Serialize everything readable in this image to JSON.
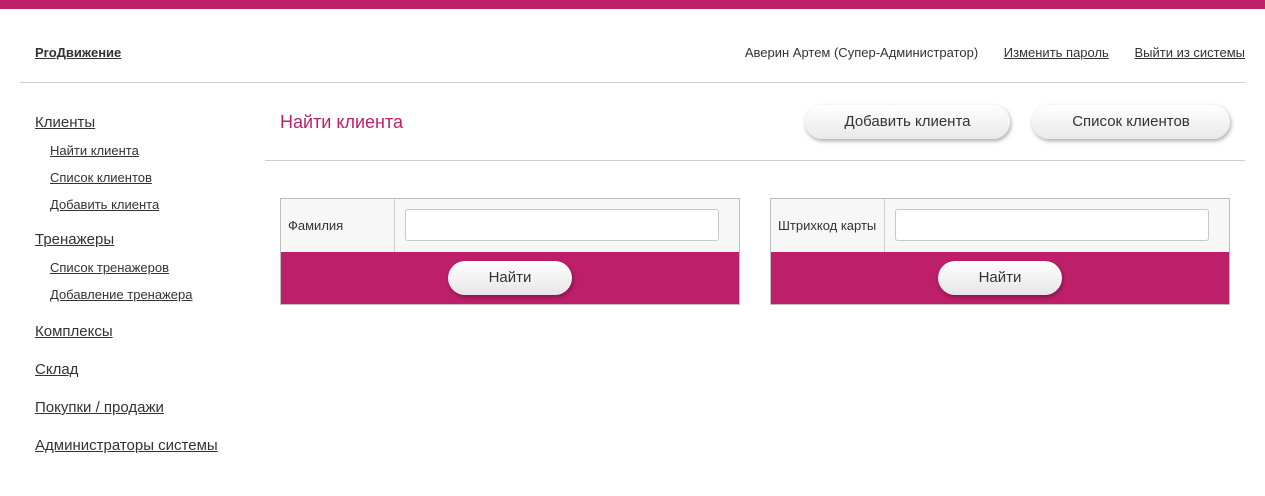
{
  "colors": {
    "accent": "#bd1f6a",
    "divider": "#cfcfcf"
  },
  "header": {
    "brand": "ProДвижение",
    "user_name": "Аверин Артем (Супер-Администратор)",
    "change_password": "Изменить пароль",
    "logout": "Выйти из системы"
  },
  "sidebar": {
    "clients": {
      "title": "Клиенты",
      "items": [
        "Найти клиента",
        "Список клиентов",
        "Добавить клиента"
      ]
    },
    "trainers": {
      "title": "Тренажеры",
      "items": [
        "Список тренажеров",
        "Добавление тренажера"
      ]
    },
    "complexes": "Комплексы",
    "warehouse": "Склад",
    "purchases": "Покупки / продажи",
    "admins": "Администраторы системы"
  },
  "main": {
    "title": "Найти клиента",
    "add_client_button": "Добавить клиента",
    "client_list_button": "Список клиентов",
    "search_by_surname": {
      "label": "Фамилия",
      "value": "",
      "button": "Найти"
    },
    "search_by_barcode": {
      "label": "Штрихкод карты",
      "value": "",
      "button": "Найти"
    }
  }
}
